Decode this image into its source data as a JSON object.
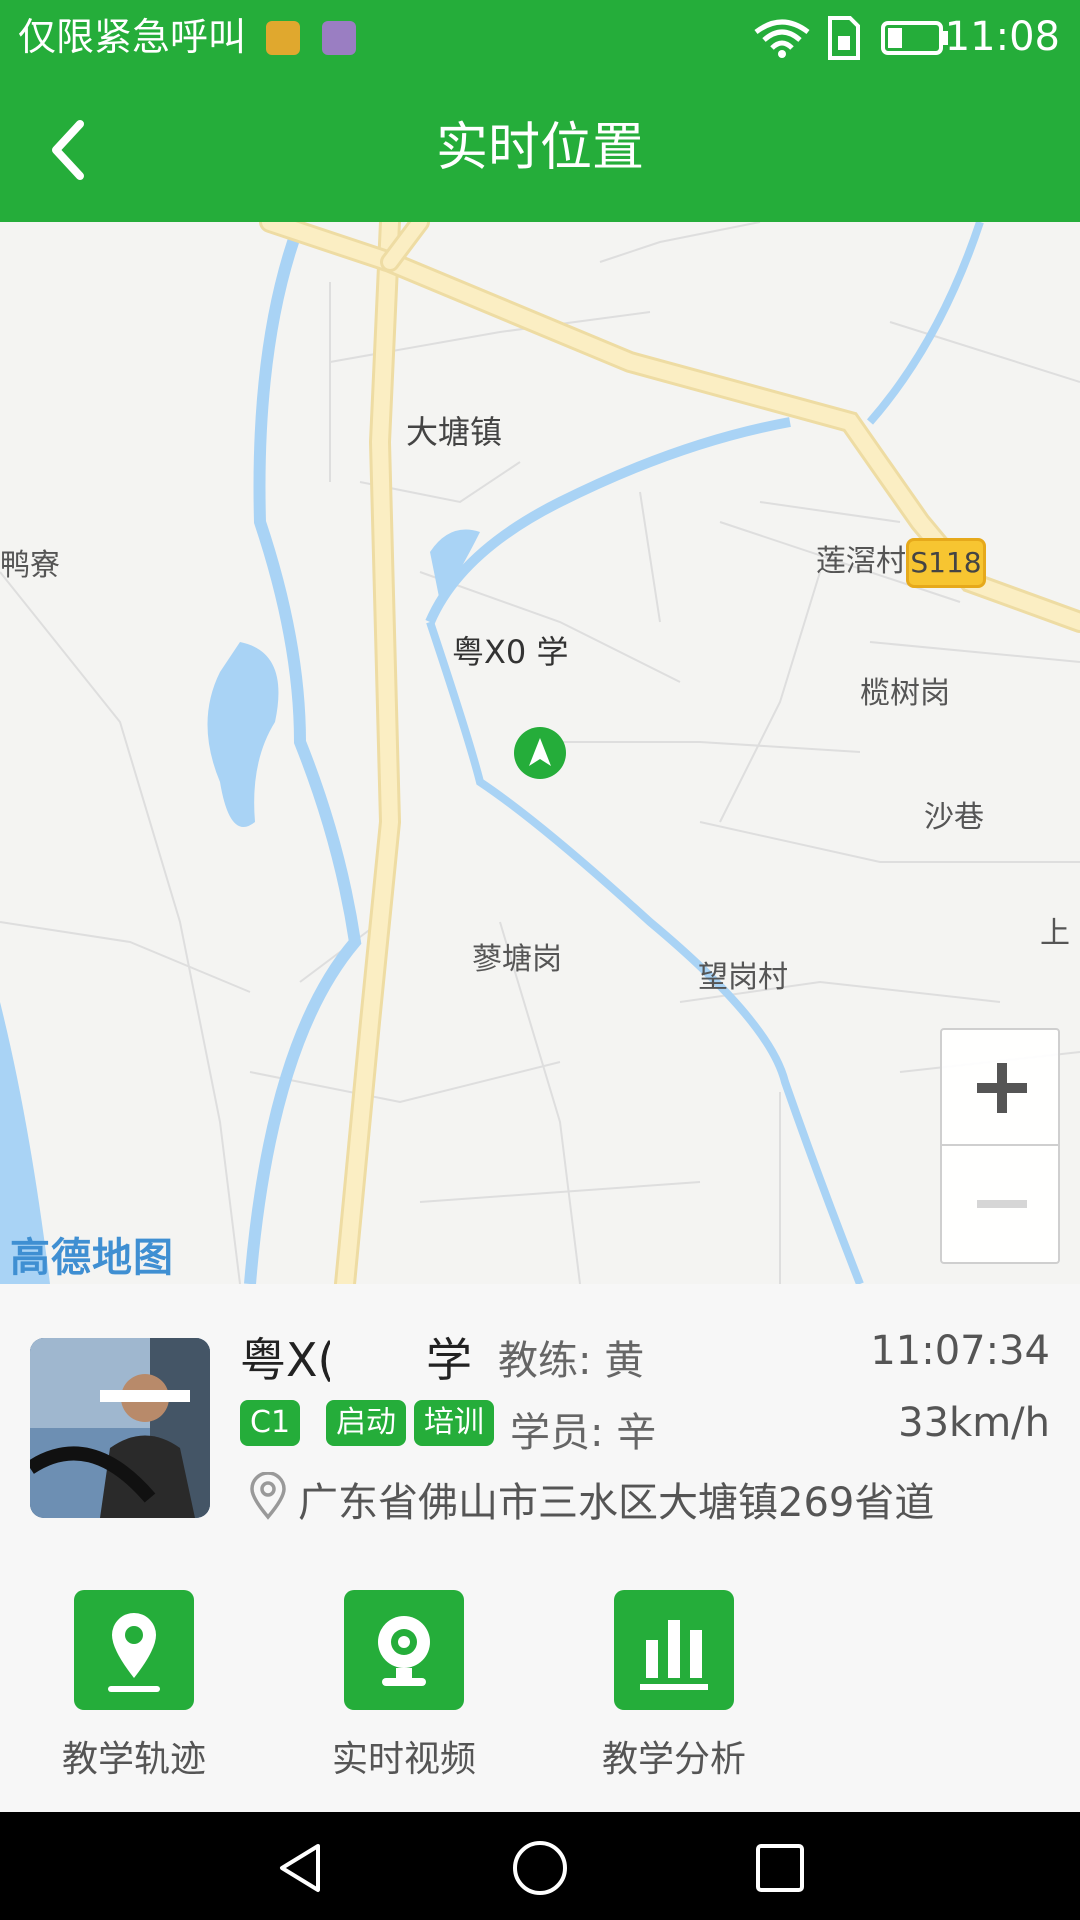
{
  "status_bar": {
    "carrier": "仅限紧急呼叫",
    "time": "11:08",
    "icons": [
      "app-badge-orange",
      "app-badge-purple",
      "wifi-icon",
      "sim-icon",
      "battery-icon"
    ]
  },
  "header": {
    "title": "实时位置",
    "back_icon": "back-arrow-icon"
  },
  "map": {
    "places": [
      "大塘镇",
      "鸭寮",
      "莲滘村",
      "榄树岗",
      "沙巷",
      "蓼塘岗",
      "望岗村",
      "上"
    ],
    "road_badge": "S118",
    "vehicle_label": "粤X0 学",
    "vehicle_icon": "navigation-arrow-icon",
    "zoom_in_icon": "plus-icon",
    "zoom_out_icon": "minus-icon",
    "provider_logo": "高德地图"
  },
  "vehicle_info": {
    "plate_start": "粤X(",
    "plate_end": "学",
    "coach": "教练: 黄",
    "timestamp": "11:07:34",
    "tags": [
      "C1",
      "启动",
      "培训"
    ],
    "student": "学员: 辛",
    "speed": "33km/h",
    "address": "广东省佛山市三水区大塘镇269省道"
  },
  "actions": [
    {
      "label": "教学轨迹",
      "icon": "location-pin-icon"
    },
    {
      "label": "实时视频",
      "icon": "webcam-icon"
    },
    {
      "label": "教学分析",
      "icon": "bar-chart-icon"
    }
  ],
  "nav_bar": [
    "back-triangle-icon",
    "home-circle-icon",
    "recents-square-icon"
  ],
  "colors": {
    "primary": "#25ad3a",
    "road": "#fbeec3",
    "water": "#a9d3f5"
  }
}
